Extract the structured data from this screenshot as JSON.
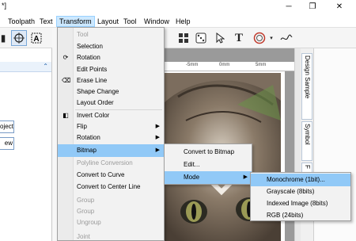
{
  "window": {
    "title_fragment": "*]",
    "min": "─",
    "max": "❐",
    "close": "✕"
  },
  "menubar": [
    "Toolpath",
    "Text",
    "Transform",
    "Layout",
    "Tool",
    "Window",
    "Help"
  ],
  "left_panel": {
    "buttons": [
      "oject",
      "ew"
    ]
  },
  "ruler_labels": [
    "-5mm",
    "0mm",
    "5mm"
  ],
  "right_dock": {
    "tabs": [
      "Design Sample",
      "Symbol",
      "F"
    ]
  },
  "transform_menu": {
    "items": [
      {
        "label": "Tool",
        "disabled": true
      },
      {
        "label": "Selection"
      },
      {
        "label": "Rotation"
      },
      {
        "label": "Edit Points"
      },
      {
        "label": "Erase Line"
      },
      {
        "label": "Shape Change"
      },
      {
        "label": "Layout Order"
      },
      {
        "label": "Invert Color"
      },
      {
        "label": "Flip",
        "submenu": true
      },
      {
        "label": "Rotation",
        "submenu": true
      },
      {
        "label": "Bitmap",
        "submenu": true,
        "highlighted": true
      },
      {
        "label": "Polyline Conversion",
        "disabled": true
      },
      {
        "label": "Convert to Curve"
      },
      {
        "label": "Convert to Center Line"
      },
      {
        "label": "Group",
        "disabled": true
      },
      {
        "label": "Group",
        "disabled": true
      },
      {
        "label": "Ungroup",
        "disabled": true
      },
      {
        "label": "Joint",
        "disabled": true
      }
    ]
  },
  "bitmap_menu": {
    "items": [
      {
        "label": "Convert to Bitmap"
      },
      {
        "label": "Edit..."
      },
      {
        "label": "Mode",
        "submenu": true,
        "highlighted": true
      }
    ]
  },
  "mode_menu": {
    "items": [
      {
        "label": "Monochrome (1bit)...",
        "highlighted": true
      },
      {
        "label": "Grayscale (8bits)"
      },
      {
        "label": "Indexed Image (8bits)"
      },
      {
        "label": "RGB (24bits)"
      }
    ]
  },
  "colors": {
    "menu_highlight": "#91c9f7",
    "active_menu": "#cce8ff",
    "accent": "#1f5fa8"
  }
}
